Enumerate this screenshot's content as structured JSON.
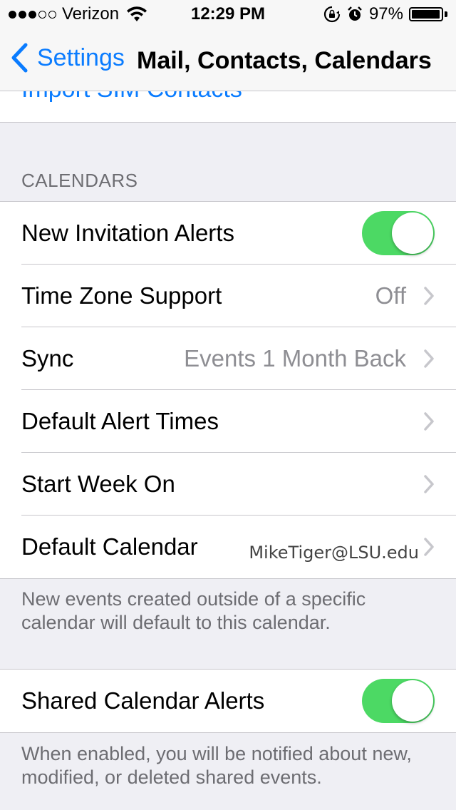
{
  "status_bar": {
    "carrier": "Verizon",
    "signal_bars": 3,
    "signal_total": 5,
    "time": "12:29 PM",
    "battery_percent": "97%",
    "battery_level": 0.97,
    "icons": [
      "wifi-icon",
      "rotation-lock-icon",
      "alarm-icon",
      "battery-icon"
    ]
  },
  "nav": {
    "back_label": "Settings",
    "title": "Mail, Contacts, Calendars"
  },
  "import_row": {
    "label": "Import SIM Contacts"
  },
  "calendars": {
    "header": "CALENDARS",
    "rows": [
      {
        "label": "New Invitation Alerts",
        "type": "toggle",
        "on": true
      },
      {
        "label": "Time Zone Support",
        "value": "Off",
        "type": "disclosure"
      },
      {
        "label": "Sync",
        "value": "Events 1 Month Back",
        "type": "disclosure"
      },
      {
        "label": "Default Alert Times",
        "value": "",
        "type": "disclosure"
      },
      {
        "label": "Start Week On",
        "value": "",
        "type": "disclosure"
      },
      {
        "label": "Default Calendar",
        "value": "MikeTiger@LSU.edu",
        "type": "disclosure"
      }
    ],
    "footer": "New events created outside of a specific calendar will default to this calendar."
  },
  "shared": {
    "row": {
      "label": "Shared Calendar Alerts",
      "type": "toggle",
      "on": true
    },
    "footer": "When enabled, you will be notified about new, modified, or deleted shared events."
  },
  "colors": {
    "accent": "#0a7cff",
    "toggle_on": "#4cd964",
    "background": "#efeff4",
    "secondary_text": "#8e8e93"
  }
}
